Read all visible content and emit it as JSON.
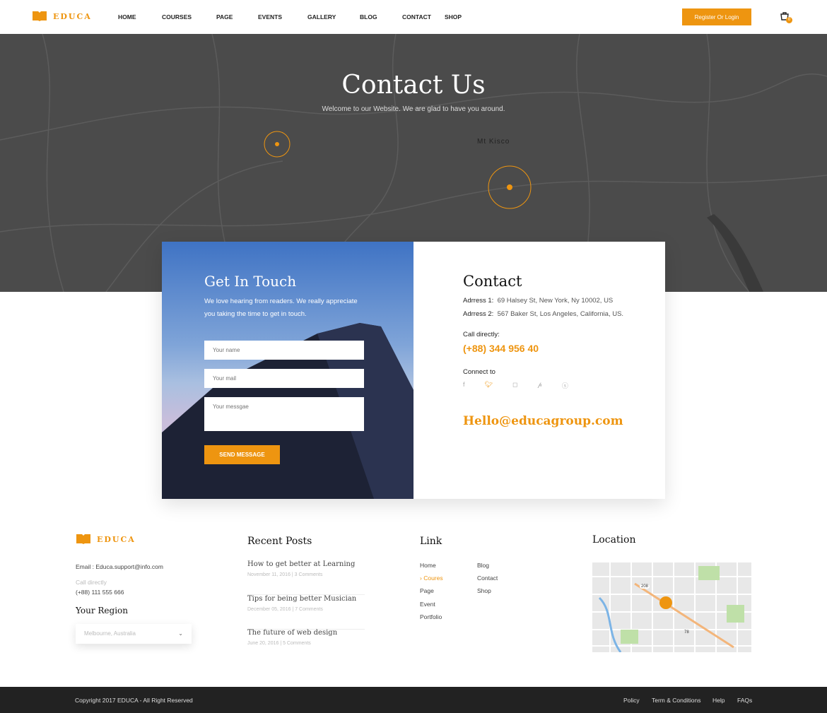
{
  "header": {
    "logo": "EDUCA",
    "nav": [
      "HOME",
      "COURSES",
      "PAGE",
      "EVENTS",
      "GALLERY",
      "BLOG",
      "CONTACT",
      "SHOP"
    ],
    "login": "Register Or Login",
    "cart_count": "0"
  },
  "hero": {
    "title": "Contact Us",
    "subtitle": "Welcome to our Website. We are glad to have you around.",
    "map_label": "Mt Kisco"
  },
  "form": {
    "title": "Get In Touch",
    "lead": "We love hearing from readers. We really appreciate you taking the time to get in touch.",
    "name_placeholder": "Your name",
    "mail_placeholder": "Your mail",
    "message_placeholder": "Your messgae",
    "send": "SEND MESSAGE"
  },
  "contact": {
    "title": "Contact",
    "address1_label": "Adrress 1:",
    "address1": "69 Halsey St, New York, Ny 10002, US",
    "address2_label": "Adrress 2:",
    "address2": "567 Baker St, Los Angeles, California, US.",
    "call_label": "Call directly:",
    "phone": "(+88) 344 956 40",
    "connect_label": "Connect to",
    "social": [
      "facebook",
      "twitter",
      "instagram",
      "pinterest",
      "skype"
    ],
    "email": "Hello@educagroup.com"
  },
  "footer": {
    "logo": "EDUCA",
    "email_label": "Email :",
    "email": "Educa.support@info.com",
    "call_label": "Call directly",
    "phone": "(+88) 111 555 666",
    "region_title": "Your Region",
    "region_value": "Melbourne, Australia",
    "posts_title": "Recent Posts",
    "posts": [
      {
        "title": "How to get better at Learning",
        "meta": "November 11, 2016  |  3 Comments"
      },
      {
        "title": "Tips for being better Musician",
        "meta": "December 05, 2016  |  7 Comments"
      },
      {
        "title": "The future of web design",
        "meta": "June 20, 2016  |  5 Comments"
      }
    ],
    "link_title": "Link",
    "links_col1": [
      "Home",
      "Coures",
      "Page",
      "Event",
      "Portfolio"
    ],
    "links_col2": [
      "Blog",
      "Contact",
      "Shop"
    ],
    "active_link": "Coures",
    "location_title": "Location",
    "map_labels": [
      "208",
      "78"
    ]
  },
  "bottom": {
    "copyright": "Copyright 2017 EDUCA - All Right Reserved",
    "links": [
      "Policy",
      "Term & Conditions",
      "Help",
      "FAQs"
    ]
  },
  "colors": {
    "accent": "#ee9510",
    "map": "#4b4b4b",
    "bottom": "#222222"
  }
}
